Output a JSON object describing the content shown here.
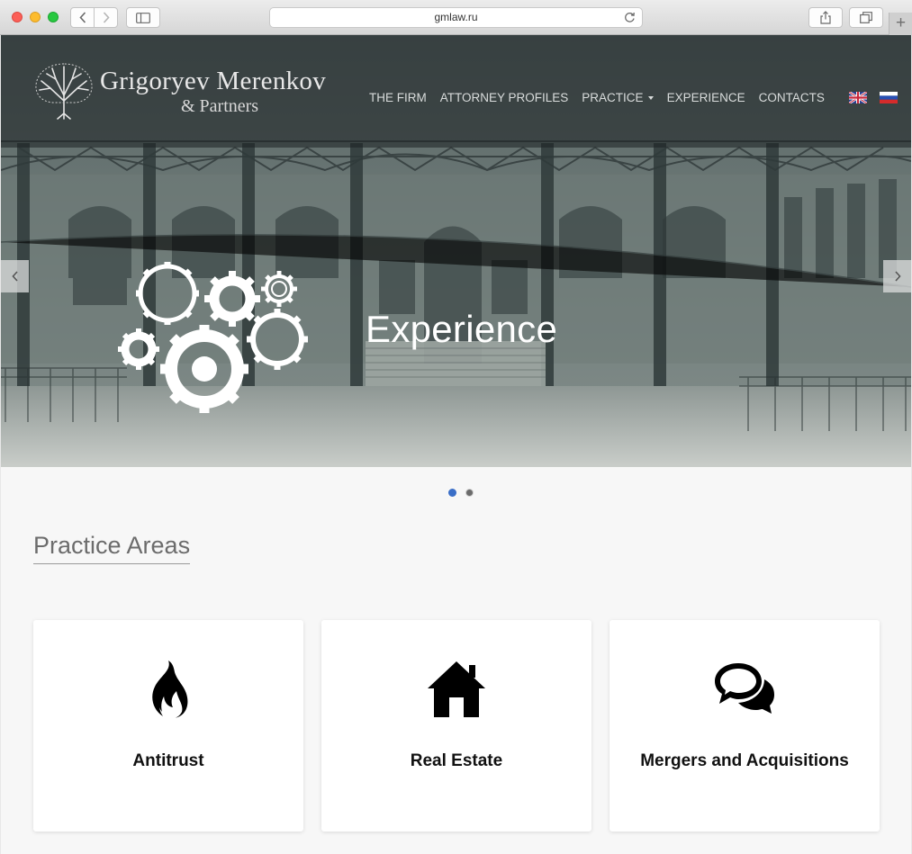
{
  "browser": {
    "url": "gmlaw.ru"
  },
  "brand": {
    "name": "Grigoryev Merenkov",
    "subtitle": "& Partners"
  },
  "nav": {
    "items": [
      "THE FIRM",
      "ATTORNEY PROFILES",
      "PRACTICE",
      "EXPERIENCE",
      "CONTACTS"
    ],
    "languages": [
      "en",
      "ru"
    ]
  },
  "slider": {
    "title": "Experience",
    "slide_count": 2,
    "active_slide": 1
  },
  "practice": {
    "heading": "Practice Areas",
    "cards": [
      {
        "label": "Antitrust",
        "icon": "fire-icon"
      },
      {
        "label": "Real Estate",
        "icon": "home-icon"
      },
      {
        "label": "Mergers and Acquisitions",
        "icon": "comments-icon"
      }
    ]
  },
  "colors": {
    "accent": "#3a6ec7",
    "card_text": "#111111",
    "heading_text": "#6c6c6c"
  }
}
